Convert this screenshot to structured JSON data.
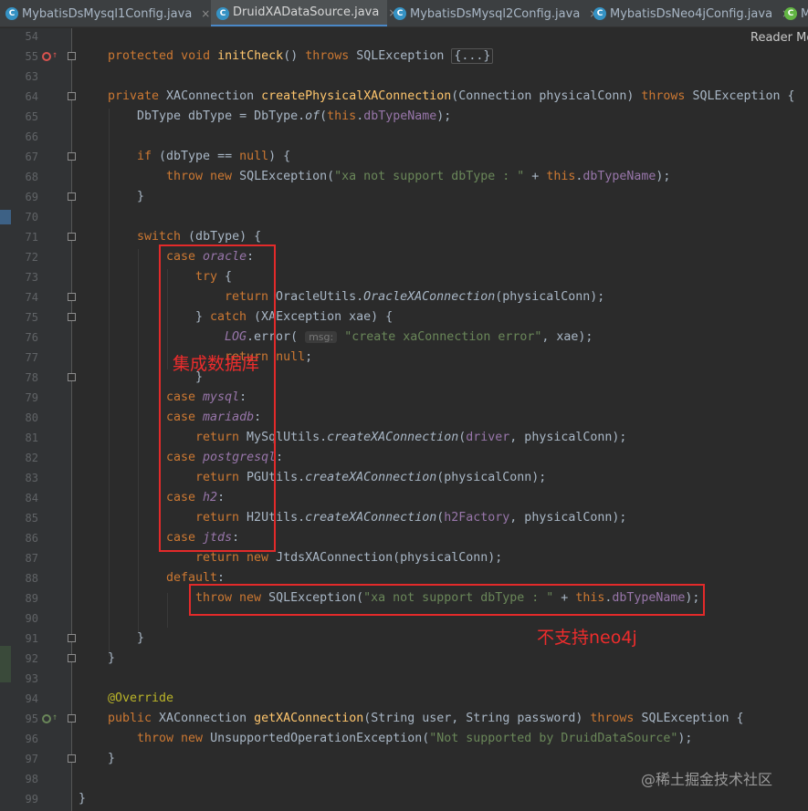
{
  "tabs": [
    {
      "label": "MybatisDsMysql1Config.java",
      "icon": "class-icon",
      "active": false
    },
    {
      "label": "DruidXADataSource.java",
      "icon": "class-icon",
      "active": true
    },
    {
      "label": "MybatisDsMysql2Config.java",
      "icon": "class-icon",
      "active": false
    },
    {
      "label": "MybatisDsNeo4jConfig.java",
      "icon": "class-icon",
      "active": false
    },
    {
      "label": "M",
      "icon": "class-icon-green",
      "active": false
    }
  ],
  "tab_close_glyph": "×",
  "reader_mode": "Reader Mo",
  "line_numbers": [
    "54",
    "55",
    "63",
    "64",
    "65",
    "66",
    "67",
    "68",
    "69",
    "70",
    "71",
    "72",
    "73",
    "74",
    "75",
    "76",
    "77",
    "78",
    "79",
    "80",
    "81",
    "82",
    "83",
    "84",
    "85",
    "86",
    "87",
    "88",
    "89",
    "90",
    "91",
    "92",
    "93",
    "94",
    "95",
    "96",
    "97",
    "98",
    "99"
  ],
  "code": {
    "l54": "",
    "l55": [
      "protected",
      "void",
      "initCheck",
      "() ",
      "throws",
      " SQLException ",
      "{...}"
    ],
    "l64": [
      "private",
      " XAConnection ",
      "createPhysicalXAConnection",
      "(Connection physicalConn) ",
      "throws",
      " SQLException {"
    ],
    "l65": [
      "DbType dbType = DbType.",
      "of",
      "(",
      "this",
      ".",
      "dbTypeName",
      ");"
    ],
    "l67": [
      "if",
      " (dbType == ",
      "null",
      ") {"
    ],
    "l68": [
      "throw new",
      " SQLException(",
      "\"xa not support dbType : \"",
      " + ",
      "this",
      ".",
      "dbTypeName",
      ");"
    ],
    "l69": "}",
    "l71": [
      "switch",
      " (dbType) {"
    ],
    "l72": [
      "case",
      " ",
      "oracle",
      ":"
    ],
    "l73": [
      "try",
      " {"
    ],
    "l74": [
      "return",
      " OracleUtils.",
      "OracleXAConnection",
      "(physicalConn);"
    ],
    "l75": [
      "} ",
      "catch",
      " (XAException xae) {"
    ],
    "l76": [
      "LOG",
      ".error( ",
      "msg:",
      " ",
      "\"create xaConnection error\"",
      ", xae);"
    ],
    "l77": [
      "return",
      " ",
      "null",
      ";"
    ],
    "l78": "}",
    "l79": [
      "case",
      " ",
      "mysql",
      ":"
    ],
    "l80": [
      "case",
      " ",
      "mariadb",
      ":"
    ],
    "l81": [
      "return",
      " MySqlUtils.",
      "createXAConnection",
      "(",
      "driver",
      ", physicalConn);"
    ],
    "l82": [
      "case",
      " ",
      "postgresql",
      ":"
    ],
    "l83": [
      "return",
      " PGUtils.",
      "createXAConnection",
      "(physicalConn);"
    ],
    "l84": [
      "case",
      " ",
      "h2",
      ":"
    ],
    "l85": [
      "return",
      " H2Utils.",
      "createXAConnection",
      "(",
      "h2Factory",
      ", physicalConn);"
    ],
    "l86": [
      "case",
      " ",
      "jtds",
      ":"
    ],
    "l87": [
      "return new",
      " JtdsXAConnection(physicalConn);"
    ],
    "l88": [
      "default",
      ":"
    ],
    "l89": [
      "throw new",
      " SQLException(",
      "\"xa not support dbType : \"",
      " + ",
      "this",
      ".",
      "dbTypeName",
      ");"
    ],
    "l91": "}",
    "l92": "}",
    "l94": "@Override",
    "l95": [
      "public",
      " XAConnection ",
      "getXAConnection",
      "(String user, String password) ",
      "throws",
      " SQLException {"
    ],
    "l96": [
      "throw new",
      " UnsupportedOperationException(",
      "\"Not supported by DruidDataSource\"",
      ");"
    ],
    "l97": "}",
    "l99": "}"
  },
  "annotations": {
    "box1_label": "集成数据库",
    "box2_label": "不支持neo4j"
  },
  "watermark": "@稀土掘金技术社区",
  "colors": {
    "background": "#2b2b2b",
    "keyword": "#cc7832",
    "method": "#ffc66d",
    "string": "#6a8759",
    "field": "#9876aa",
    "annotation": "#bbb529",
    "red_annotation": "#e32a2a"
  }
}
